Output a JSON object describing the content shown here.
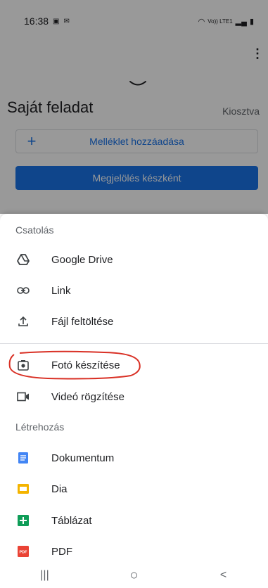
{
  "status_bar": {
    "time": "16:38",
    "carrier": "Vo)) LTE1"
  },
  "task": {
    "title": "Saját feladat",
    "status": "Kiosztva",
    "add_attachment_label": "Melléklet hozzáadása",
    "mark_done_label": "Megjelölés készként"
  },
  "sheet": {
    "attach_header": "Csatolás",
    "attach_items": [
      {
        "label": "Google Drive",
        "icon": "google-drive-icon"
      },
      {
        "label": "Link",
        "icon": "link-icon"
      },
      {
        "label": "Fájl feltöltése",
        "icon": "upload-icon"
      }
    ],
    "capture_items": [
      {
        "label": "Fotó készítése",
        "icon": "camera-icon"
      },
      {
        "label": "Videó rögzítése",
        "icon": "video-icon"
      }
    ],
    "create_header": "Létrehozás",
    "create_items": [
      {
        "label": "Dokumentum",
        "icon": "docs-icon",
        "color": "#4285f4"
      },
      {
        "label": "Dia",
        "icon": "slides-icon",
        "color": "#f4b400"
      },
      {
        "label": "Táblázat",
        "icon": "sheets-icon",
        "color": "#0f9d58"
      },
      {
        "label": "PDF",
        "icon": "pdf-icon",
        "color": "#ea4335",
        "badge": "PDF"
      }
    ]
  },
  "nav": {
    "recents": "|||",
    "home": "○",
    "back": "<"
  },
  "colors": {
    "accent": "#1a73e8",
    "highlight": "#d93025"
  }
}
